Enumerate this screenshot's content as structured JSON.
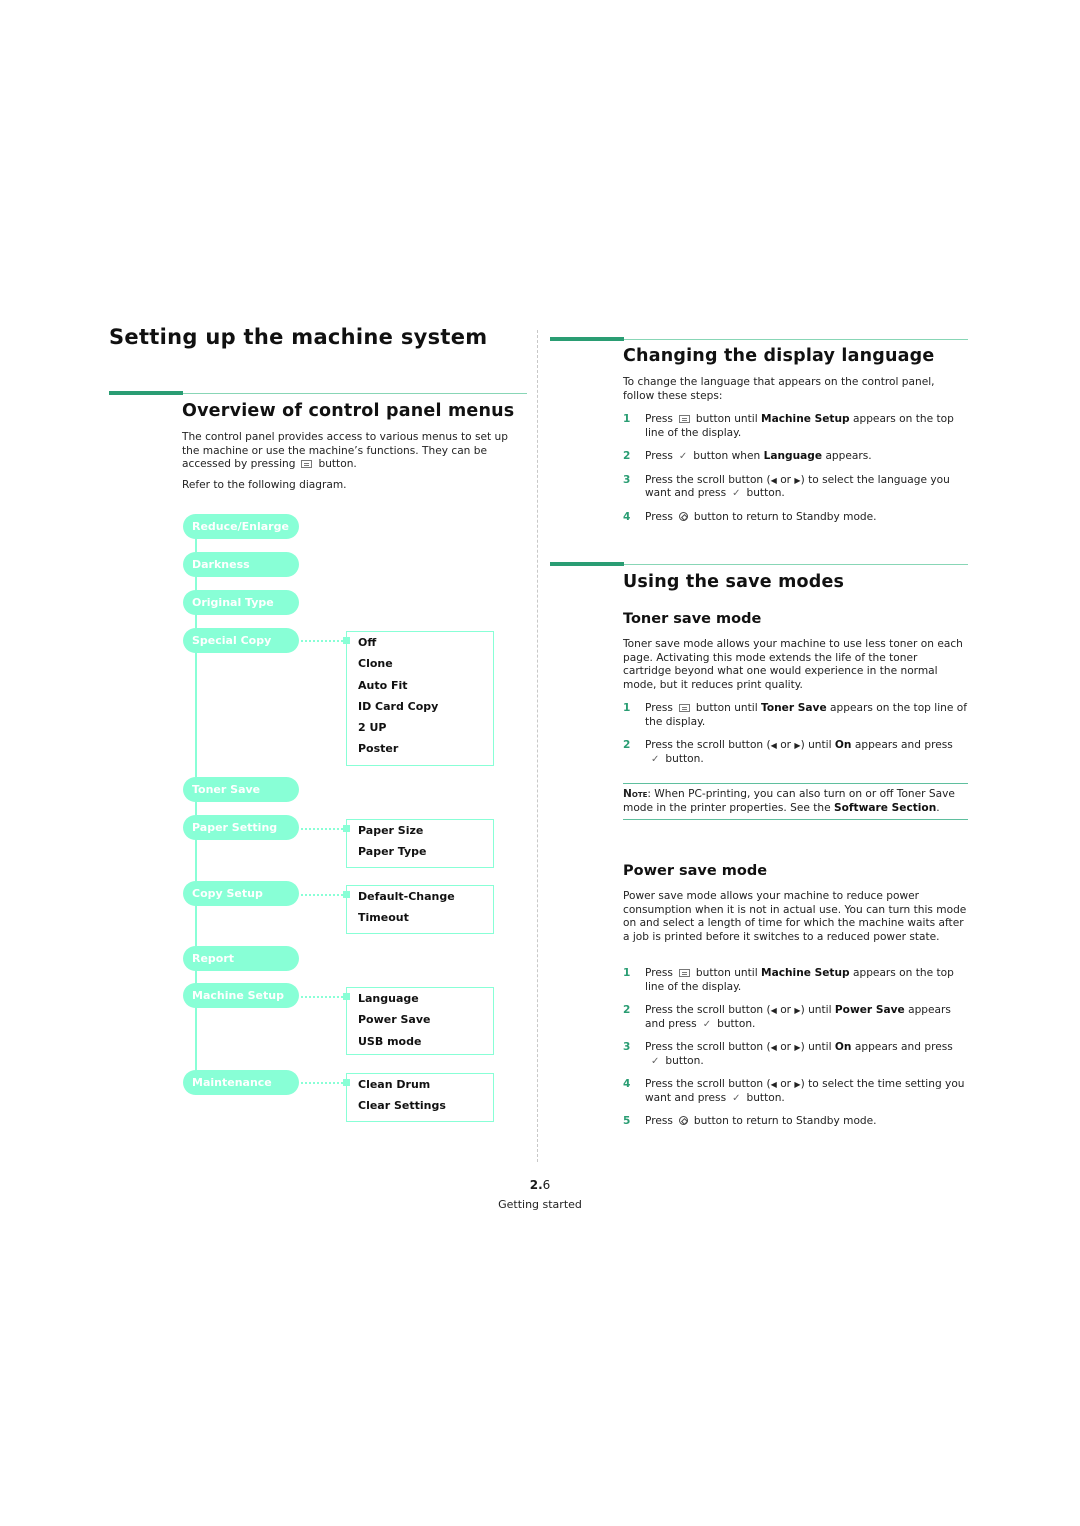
{
  "page_title": "Setting up the machine system",
  "overview": {
    "heading": "Overview of control panel menus",
    "para1_before": "The control panel provides access to various menus to set up the machine or use the machine’s functions. They can be accessed by pressing",
    "para1_after": "button.",
    "para2": "Refer to the following diagram.",
    "menu_icon": "menu-button-icon"
  },
  "diagram": {
    "color": "#88ffd6",
    "menus": [
      {
        "label": "Reduce/Enlarge",
        "submenu": []
      },
      {
        "label": "Darkness",
        "submenu": []
      },
      {
        "label": "Original Type",
        "submenu": []
      },
      {
        "label": "Special Copy",
        "submenu": [
          "Off",
          "Clone",
          "Auto Fit",
          "ID Card Copy",
          "2 UP",
          "Poster"
        ]
      },
      {
        "label": "Toner Save",
        "submenu": []
      },
      {
        "label": "Paper Setting",
        "submenu": [
          "Paper Size",
          "Paper Type"
        ]
      },
      {
        "label": "Copy Setup",
        "submenu": [
          "Default-Change",
          "Timeout"
        ]
      },
      {
        "label": "Report",
        "submenu": []
      },
      {
        "label": "Machine Setup",
        "submenu": [
          "Language",
          "Power Save",
          "USB mode"
        ]
      },
      {
        "label": "Maintenance",
        "submenu": [
          "Clean Drum",
          "Clear Settings"
        ]
      }
    ]
  },
  "language": {
    "heading": "Changing the display language",
    "intro": "To change the language that appears on the control panel, follow these steps:",
    "steps": [
      {
        "n": "1",
        "a": "Press",
        "b": "button until",
        "bold": "Machine Setup",
        "c": "appears on the top line of the display."
      },
      {
        "n": "2",
        "a": "Press",
        "b": "button when",
        "bold": "Language",
        "c": "appears."
      },
      {
        "n": "3",
        "a": "Press the scroll button (",
        "or": "or",
        "b": ") to select the language you want and press",
        "c": "button."
      },
      {
        "n": "4",
        "a": "Press",
        "b": "button to return to Standby mode."
      }
    ]
  },
  "save_modes": {
    "heading": "Using the save modes",
    "toner": {
      "heading": "Toner save mode",
      "intro": "Toner save mode allows your machine to use less toner on each page. Activating this mode extends the life of the toner cartridge beyond what one would experience in the normal mode, but it reduces print quality.",
      "steps": [
        {
          "n": "1",
          "a": "Press",
          "b": "button until",
          "bold": "Toner Save",
          "c": "appears on the top line of the display."
        },
        {
          "n": "2",
          "a": "Press the scroll button (",
          "or": "or",
          "b": ") until",
          "bold": "On",
          "c": "appears and press",
          "d": "button."
        }
      ]
    },
    "note": {
      "label": "Note",
      "text": ": When PC-printing, you can also turn on or off Toner Save mode in the printer properties. See the",
      "bold": "Software Section",
      "end": "."
    },
    "power": {
      "heading": "Power save mode",
      "intro": "Power save mode allows your machine to reduce power consumption when it is not in actual use. You can turn this mode on and select a length of time for which the machine waits after a job is printed before it switches to a reduced power state.",
      "steps": [
        {
          "n": "1",
          "a": "Press",
          "b": "button until",
          "bold": "Machine Setup",
          "c": "appears on the top line of the display."
        },
        {
          "n": "2",
          "a": "Press the scroll button (",
          "or": "or",
          "b": ") until",
          "bold": "Power Save",
          "c": "appears and press",
          "d": "button."
        },
        {
          "n": "3",
          "a": "Press the scroll button (",
          "or": "or",
          "b": ") until",
          "bold": "On",
          "c": "appears and press",
          "d": "button."
        },
        {
          "n": "4",
          "a": "Press the scroll button (",
          "or": "or",
          "b": ") to select the time setting you want and press",
          "c": "button."
        },
        {
          "n": "5",
          "a": "Press",
          "b": "button to return to Standby mode."
        }
      ]
    }
  },
  "footer": {
    "page_bold": "2.",
    "page_rest": "6",
    "chapter": "Getting started"
  },
  "colors": {
    "accent": "#2a9d73",
    "accent_light": "#88d6b6",
    "diagram": "#88ffd6"
  }
}
